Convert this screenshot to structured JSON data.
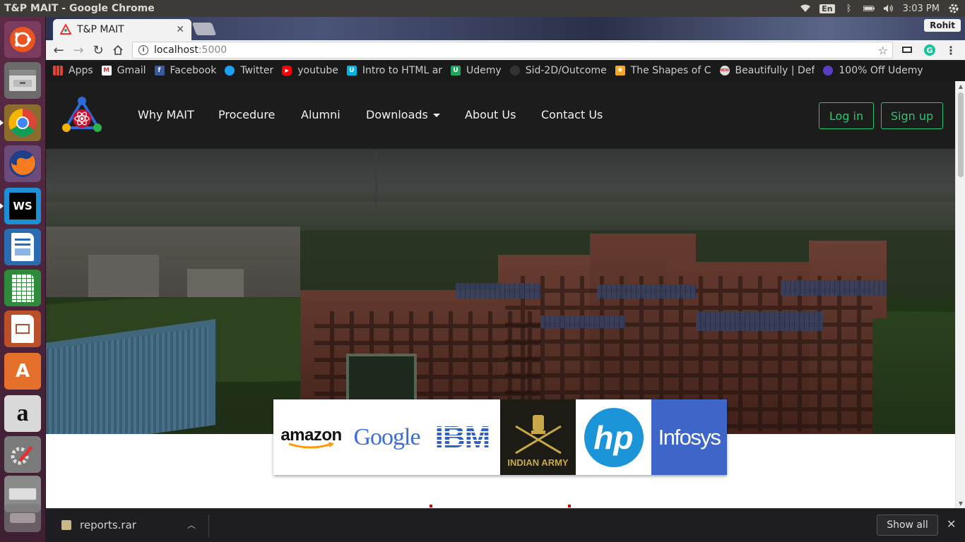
{
  "os": {
    "window_title": "T&P MAIT - Google Chrome",
    "keyboard_layout": "En",
    "clock": "3:03 PM",
    "user": "Rohit",
    "launcher_items": [
      "ubuntu-dash",
      "file-manager",
      "chrome",
      "firefox",
      "webstorm",
      "libreoffice-writer",
      "libreoffice-calc",
      "libreoffice-impress",
      "software-center",
      "amazon",
      "system-settings",
      "disk-drive",
      "trash"
    ]
  },
  "browser": {
    "tab_title": "T&P MAIT",
    "url_host": "localhost",
    "url_port": ":5000",
    "bookmarks": [
      {
        "label": "Apps",
        "icon": "apps-grid-icon",
        "color": "#4285f4"
      },
      {
        "label": "Gmail",
        "icon": "gmail-icon",
        "color": "#d93025"
      },
      {
        "label": "Facebook",
        "icon": "facebook-icon",
        "color": "#3b5998"
      },
      {
        "label": "Twitter",
        "icon": "twitter-icon",
        "color": "#1da1f2"
      },
      {
        "label": "youtube",
        "icon": "youtube-icon",
        "color": "#ff0000"
      },
      {
        "label": "Intro to HTML ar",
        "icon": "udacity-icon",
        "color": "#02b3e4"
      },
      {
        "label": "Udemy",
        "icon": "udemy-icon",
        "color": "#1ea55d"
      },
      {
        "label": "Sid-2D/Outcome",
        "icon": "github-icon",
        "color": "#333333"
      },
      {
        "label": "The Shapes of C",
        "icon": "asterisk-icon",
        "color": "#f5a623"
      },
      {
        "label": "Beautifully | Def",
        "icon": "new-badge-icon",
        "color": "#dddddd"
      },
      {
        "label": "100% Off Udemy",
        "icon": "coupon-icon",
        "color": "#5b3cc4"
      }
    ]
  },
  "site": {
    "nav": [
      "Why MAIT",
      "Procedure",
      "Alumni",
      "Downloads",
      "About Us",
      "Contact Us"
    ],
    "login_label": "Log in",
    "signup_label": "Sign up",
    "accent": "#28c76f",
    "recruiters": [
      {
        "name": "amazon",
        "bg": "#ffffff"
      },
      {
        "name": "Google",
        "bg": "#ffffff"
      },
      {
        "name": "IBM",
        "bg": "#ffffff"
      },
      {
        "name": "INDIAN ARMY",
        "bg": "#1c1c14"
      },
      {
        "name": "hp",
        "bg": "#ffffff"
      },
      {
        "name": "Infosys",
        "bg": "#3e66c9"
      }
    ]
  },
  "downloads": {
    "file_name": "reports.rar",
    "show_all_label": "Show all"
  }
}
